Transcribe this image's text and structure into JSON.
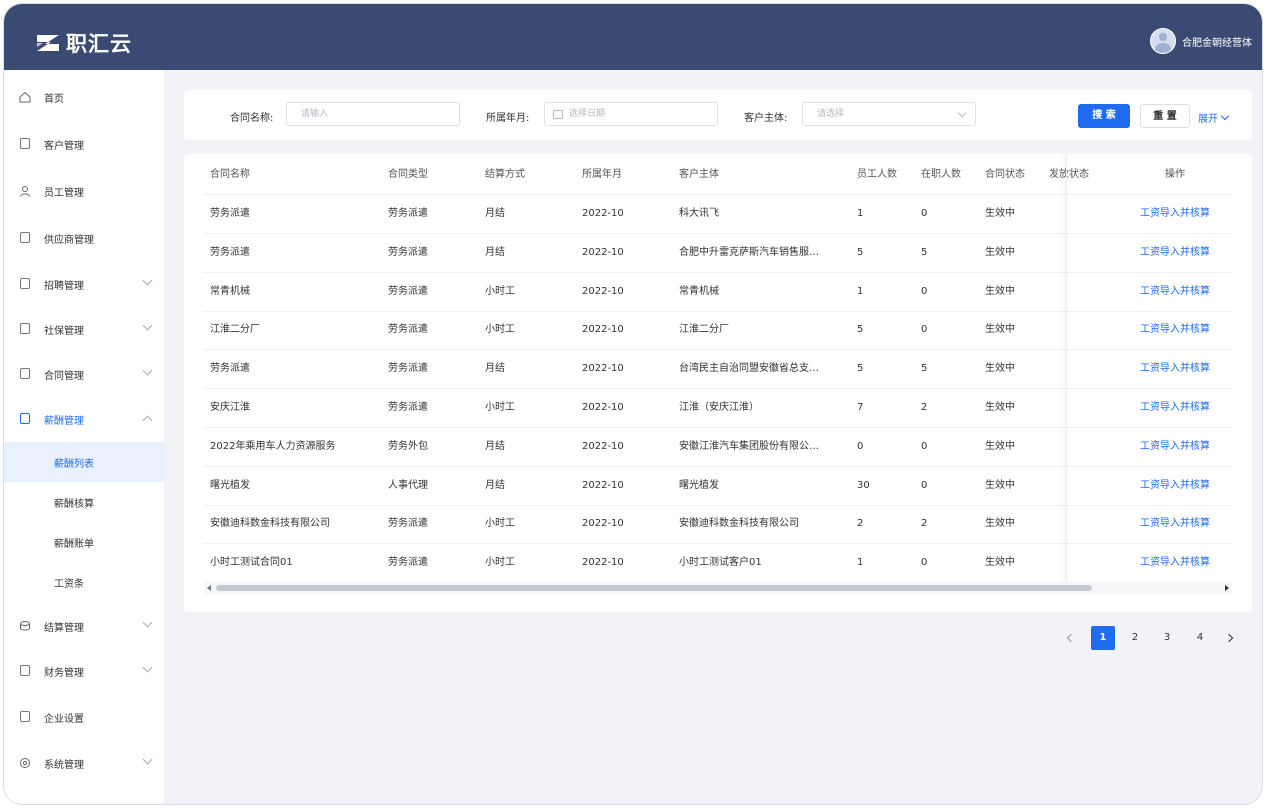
{
  "header": {
    "brand": "职汇云",
    "user_name": "合肥金朝经营体"
  },
  "sidebar": {
    "items": [
      {
        "label": "首页",
        "icon": "home-icon"
      },
      {
        "label": "客户管理",
        "icon": "building-icon"
      },
      {
        "label": "员工管理",
        "icon": "user-icon"
      },
      {
        "label": "供应商管理",
        "icon": "supplier-icon"
      },
      {
        "label": "招聘管理",
        "icon": "recruit-icon"
      },
      {
        "label": "社保管理",
        "icon": "social-security-icon"
      },
      {
        "label": "合同管理",
        "icon": "contract-icon"
      },
      {
        "label": "薪酬管理",
        "icon": "salary-icon"
      }
    ],
    "sub_items": [
      "薪酬列表",
      "薪酬核算",
      "薪酬账单",
      "工资条"
    ],
    "items_bottom": [
      {
        "label": "结算管理",
        "icon": "settlement-icon"
      },
      {
        "label": "财务管理",
        "icon": "finance-icon"
      },
      {
        "label": "企业设置",
        "icon": "enterprise-icon"
      },
      {
        "label": "系统管理",
        "icon": "system-icon"
      }
    ]
  },
  "filters": {
    "contract_name_label": "合同名称:",
    "contract_name_placeholder": "请输入",
    "month_label": "所属年月:",
    "month_placeholder": "选择日期",
    "customer_label": "客户主体:",
    "customer_placeholder": "请选择",
    "search_label": "搜 索",
    "reset_label": "重 置",
    "expand_label": "展开"
  },
  "table": {
    "columns": [
      "合同名称",
      "合同类型",
      "结算方式",
      "所属年月",
      "客户主体",
      "员工人数",
      "在职人数",
      "合同状态",
      "发放状态",
      "操作"
    ],
    "rows": [
      [
        "劳务派遣",
        "劳务派遣",
        "月结",
        "2022-10",
        "科大讯飞",
        "1",
        "0",
        "生效中",
        "",
        "工资导入并核算"
      ],
      [
        "劳务派遣",
        "劳务派遣",
        "月结",
        "2022-10",
        "合肥中升雷克萨斯汽车销售服…",
        "5",
        "5",
        "生效中",
        "",
        "工资导入并核算"
      ],
      [
        "常青机械",
        "劳务派遣",
        "小时工",
        "2022-10",
        "常青机械",
        "1",
        "0",
        "生效中",
        "",
        "工资导入并核算"
      ],
      [
        "江淮二分厂",
        "劳务派遣",
        "小时工",
        "2022-10",
        "江淮二分厂",
        "5",
        "0",
        "生效中",
        "",
        "工资导入并核算"
      ],
      [
        "劳务派遣",
        "劳务派遣",
        "月结",
        "2022-10",
        "台湾民主自治同盟安徽省总支…",
        "5",
        "5",
        "生效中",
        "",
        "工资导入并核算"
      ],
      [
        "安庆江淮",
        "劳务派遣",
        "小时工",
        "2022-10",
        "江淮（安庆江淮）",
        "7",
        "2",
        "生效中",
        "",
        "工资导入并核算"
      ],
      [
        "2022年乘用车人力资源服务",
        "劳务外包",
        "月结",
        "2022-10",
        "安徽江淮汽车集团股份有限公…",
        "0",
        "0",
        "生效中",
        "",
        "工资导入并核算"
      ],
      [
        "曙光植发",
        "人事代理",
        "月结",
        "2022-10",
        "曙光植发",
        "30",
        "0",
        "生效中",
        "",
        "工资导入并核算"
      ],
      [
        "安徽迪科数金科技有限公司",
        "劳务派遣",
        "小时工",
        "2022-10",
        "安徽迪科数金科技有限公司",
        "2",
        "2",
        "生效中",
        "",
        "工资导入并核算"
      ],
      [
        "小时工测试合同01",
        "劳务派遣",
        "小时工",
        "2022-10",
        "小时工测试客户01",
        "1",
        "0",
        "生效中",
        "",
        "工资导入并核算"
      ]
    ]
  },
  "pagination": {
    "pages": [
      "1",
      "2",
      "3",
      "4"
    ],
    "current": "1"
  },
  "colors": {
    "header_bg": "#3b4a72",
    "accent": "#1f6cf0",
    "page_bg": "#f2f3f7"
  }
}
